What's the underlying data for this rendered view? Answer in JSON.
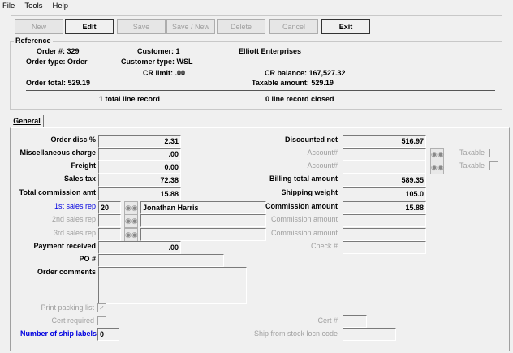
{
  "menu": [
    "File",
    "Tools",
    "Help"
  ],
  "toolbar": {
    "new": "New",
    "edit": "Edit",
    "save": "Save",
    "save_new": "Save / New",
    "delete": "Delete",
    "cancel": "Cancel",
    "exit": "Exit"
  },
  "reference": {
    "title": "Reference",
    "order_no": "Order #: 329",
    "customer": "Customer: 1",
    "customer_name": "Elliott Enterprises",
    "order_type": "Order type: Order",
    "customer_type": "Customer type: WSL",
    "cr_limit": "CR limit: .00",
    "cr_balance": "CR balance: 167,527.32",
    "order_total": "Order total: 529.19",
    "taxable_amount": "Taxable amount: 529.19",
    "total_lines": "1 total line record",
    "closed_lines": "0 line record closed"
  },
  "tab": "General",
  "left": {
    "order_disc": {
      "label": "Order disc %",
      "value": "2.31"
    },
    "misc_charge": {
      "label": "Miscellaneous charge",
      "value": ".00"
    },
    "freight": {
      "label": "Freight",
      "value": "0.00"
    },
    "sales_tax": {
      "label": "Sales tax",
      "value": "72.38"
    },
    "total_commission": {
      "label": "Total commission amt",
      "value": "15.88"
    },
    "rep1": {
      "label": "1st sales rep",
      "code": "20",
      "name": "Jonathan Harris"
    },
    "rep2": {
      "label": "2nd sales rep",
      "code": "",
      "name": ""
    },
    "rep3": {
      "label": "3rd sales rep",
      "code": "",
      "name": ""
    },
    "payment": {
      "label": "Payment received",
      "value": ".00"
    },
    "po": {
      "label": "PO #",
      "value": ""
    },
    "comments": {
      "label": "Order comments",
      "value": ""
    },
    "print_packing": {
      "label": "Print packing list",
      "checked": true
    },
    "cert_required": {
      "label": "Cert required",
      "checked": false
    },
    "ship_labels": {
      "label": "Number of ship labels",
      "value": "0"
    }
  },
  "right": {
    "discounted_net": {
      "label": "Discounted net",
      "value": "516.97"
    },
    "account1": {
      "label": "Account#",
      "value": "",
      "taxable": "Taxable"
    },
    "account2": {
      "label": "Account#",
      "value": "",
      "taxable": "Taxable"
    },
    "billing_total": {
      "label": "Billing total amount",
      "value": "589.35"
    },
    "shipping_weight": {
      "label": "Shipping weight",
      "value": "105.0"
    },
    "commission1": {
      "label": "Commission amount",
      "value": "15.88"
    },
    "commission2": {
      "label": "Commission amount",
      "value": ""
    },
    "commission3": {
      "label": "Commission amount",
      "value": ""
    },
    "check": {
      "label": "Check #",
      "value": ""
    },
    "cert_no": {
      "label": "Cert #",
      "value": ""
    },
    "ship_from": {
      "label": "Ship from stock locn code",
      "value": ""
    }
  }
}
